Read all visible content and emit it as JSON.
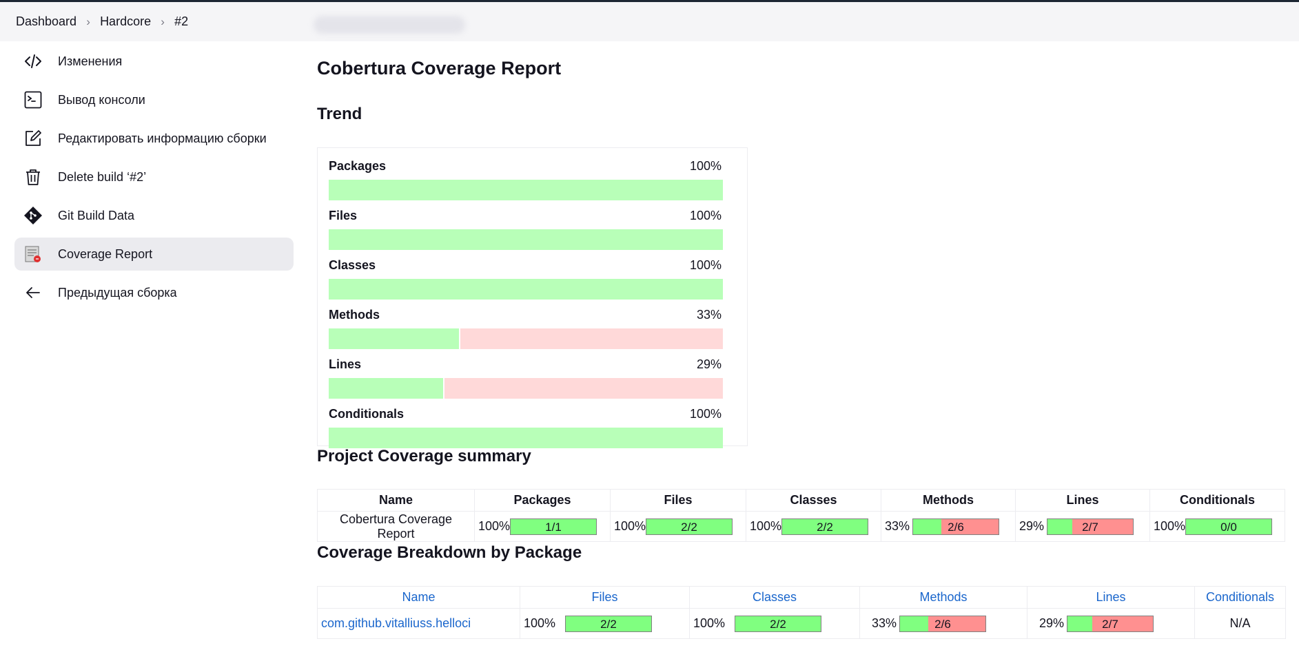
{
  "breadcrumb": {
    "items": [
      "Dashboard",
      "Hardcore",
      "#2"
    ]
  },
  "sidebar": {
    "items": [
      {
        "label": "Изменения",
        "icon": "code-icon"
      },
      {
        "label": "Вывод консоли",
        "icon": "terminal-icon"
      },
      {
        "label": "Редактировать информацию сборки",
        "icon": "edit-icon"
      },
      {
        "label": "Delete build ‘#2’",
        "icon": "trash-icon"
      },
      {
        "label": "Git Build Data",
        "icon": "git-icon"
      },
      {
        "label": "Coverage Report",
        "icon": "coverage-report-icon",
        "active": true
      },
      {
        "label": "Предыдущая сборка",
        "icon": "arrow-left-icon"
      }
    ]
  },
  "page": {
    "title": "Cobertura Coverage Report",
    "trend_heading": "Trend",
    "summary_heading": "Project Coverage summary",
    "breakdown_heading": "Coverage Breakdown by Package"
  },
  "trend": [
    {
      "label": "Packages",
      "percent": "100%",
      "fraction": 1.0
    },
    {
      "label": "Files",
      "percent": "100%",
      "fraction": 1.0
    },
    {
      "label": "Classes",
      "percent": "100%",
      "fraction": 1.0
    },
    {
      "label": "Methods",
      "percent": "33%",
      "fraction": 0.33
    },
    {
      "label": "Lines",
      "percent": "29%",
      "fraction": 0.29
    },
    {
      "label": "Conditionals",
      "percent": "100%",
      "fraction": 1.0
    }
  ],
  "summary": {
    "headers": [
      "Name",
      "Packages",
      "Files",
      "Classes",
      "Methods",
      "Lines",
      "Conditionals"
    ],
    "row": {
      "name": "Cobertura Coverage Report",
      "cells": [
        {
          "percent": "100%",
          "ratio": "1/1",
          "fraction": 1.0
        },
        {
          "percent": "100%",
          "ratio": "2/2",
          "fraction": 1.0
        },
        {
          "percent": "100%",
          "ratio": "2/2",
          "fraction": 1.0
        },
        {
          "percent": "33%",
          "ratio": "2/6",
          "fraction": 0.33
        },
        {
          "percent": "29%",
          "ratio": "2/7",
          "fraction": 0.29
        },
        {
          "percent": "100%",
          "ratio": "0/0",
          "fraction": 1.0
        }
      ]
    }
  },
  "breakdown": {
    "headers": [
      "Name",
      "Files",
      "Classes",
      "Methods",
      "Lines",
      "Conditionals"
    ],
    "row": {
      "name": "com.github.vitalliuss.helloci",
      "cells": [
        {
          "percent": "100%",
          "ratio": "2/2",
          "fraction": 1.0
        },
        {
          "percent": "100%",
          "ratio": "2/2",
          "fraction": 1.0
        },
        {
          "percent": "33%",
          "ratio": "2/6",
          "fraction": 0.33
        },
        {
          "percent": "29%",
          "ratio": "2/7",
          "fraction": 0.29
        }
      ],
      "conditionals": "N/A"
    }
  },
  "colors": {
    "bar_green": "#80ff80",
    "bar_red": "#ff9090",
    "trend_green": "#b8ffb8",
    "trend_red": "#ffd9d9",
    "link": "#1a66cc"
  }
}
